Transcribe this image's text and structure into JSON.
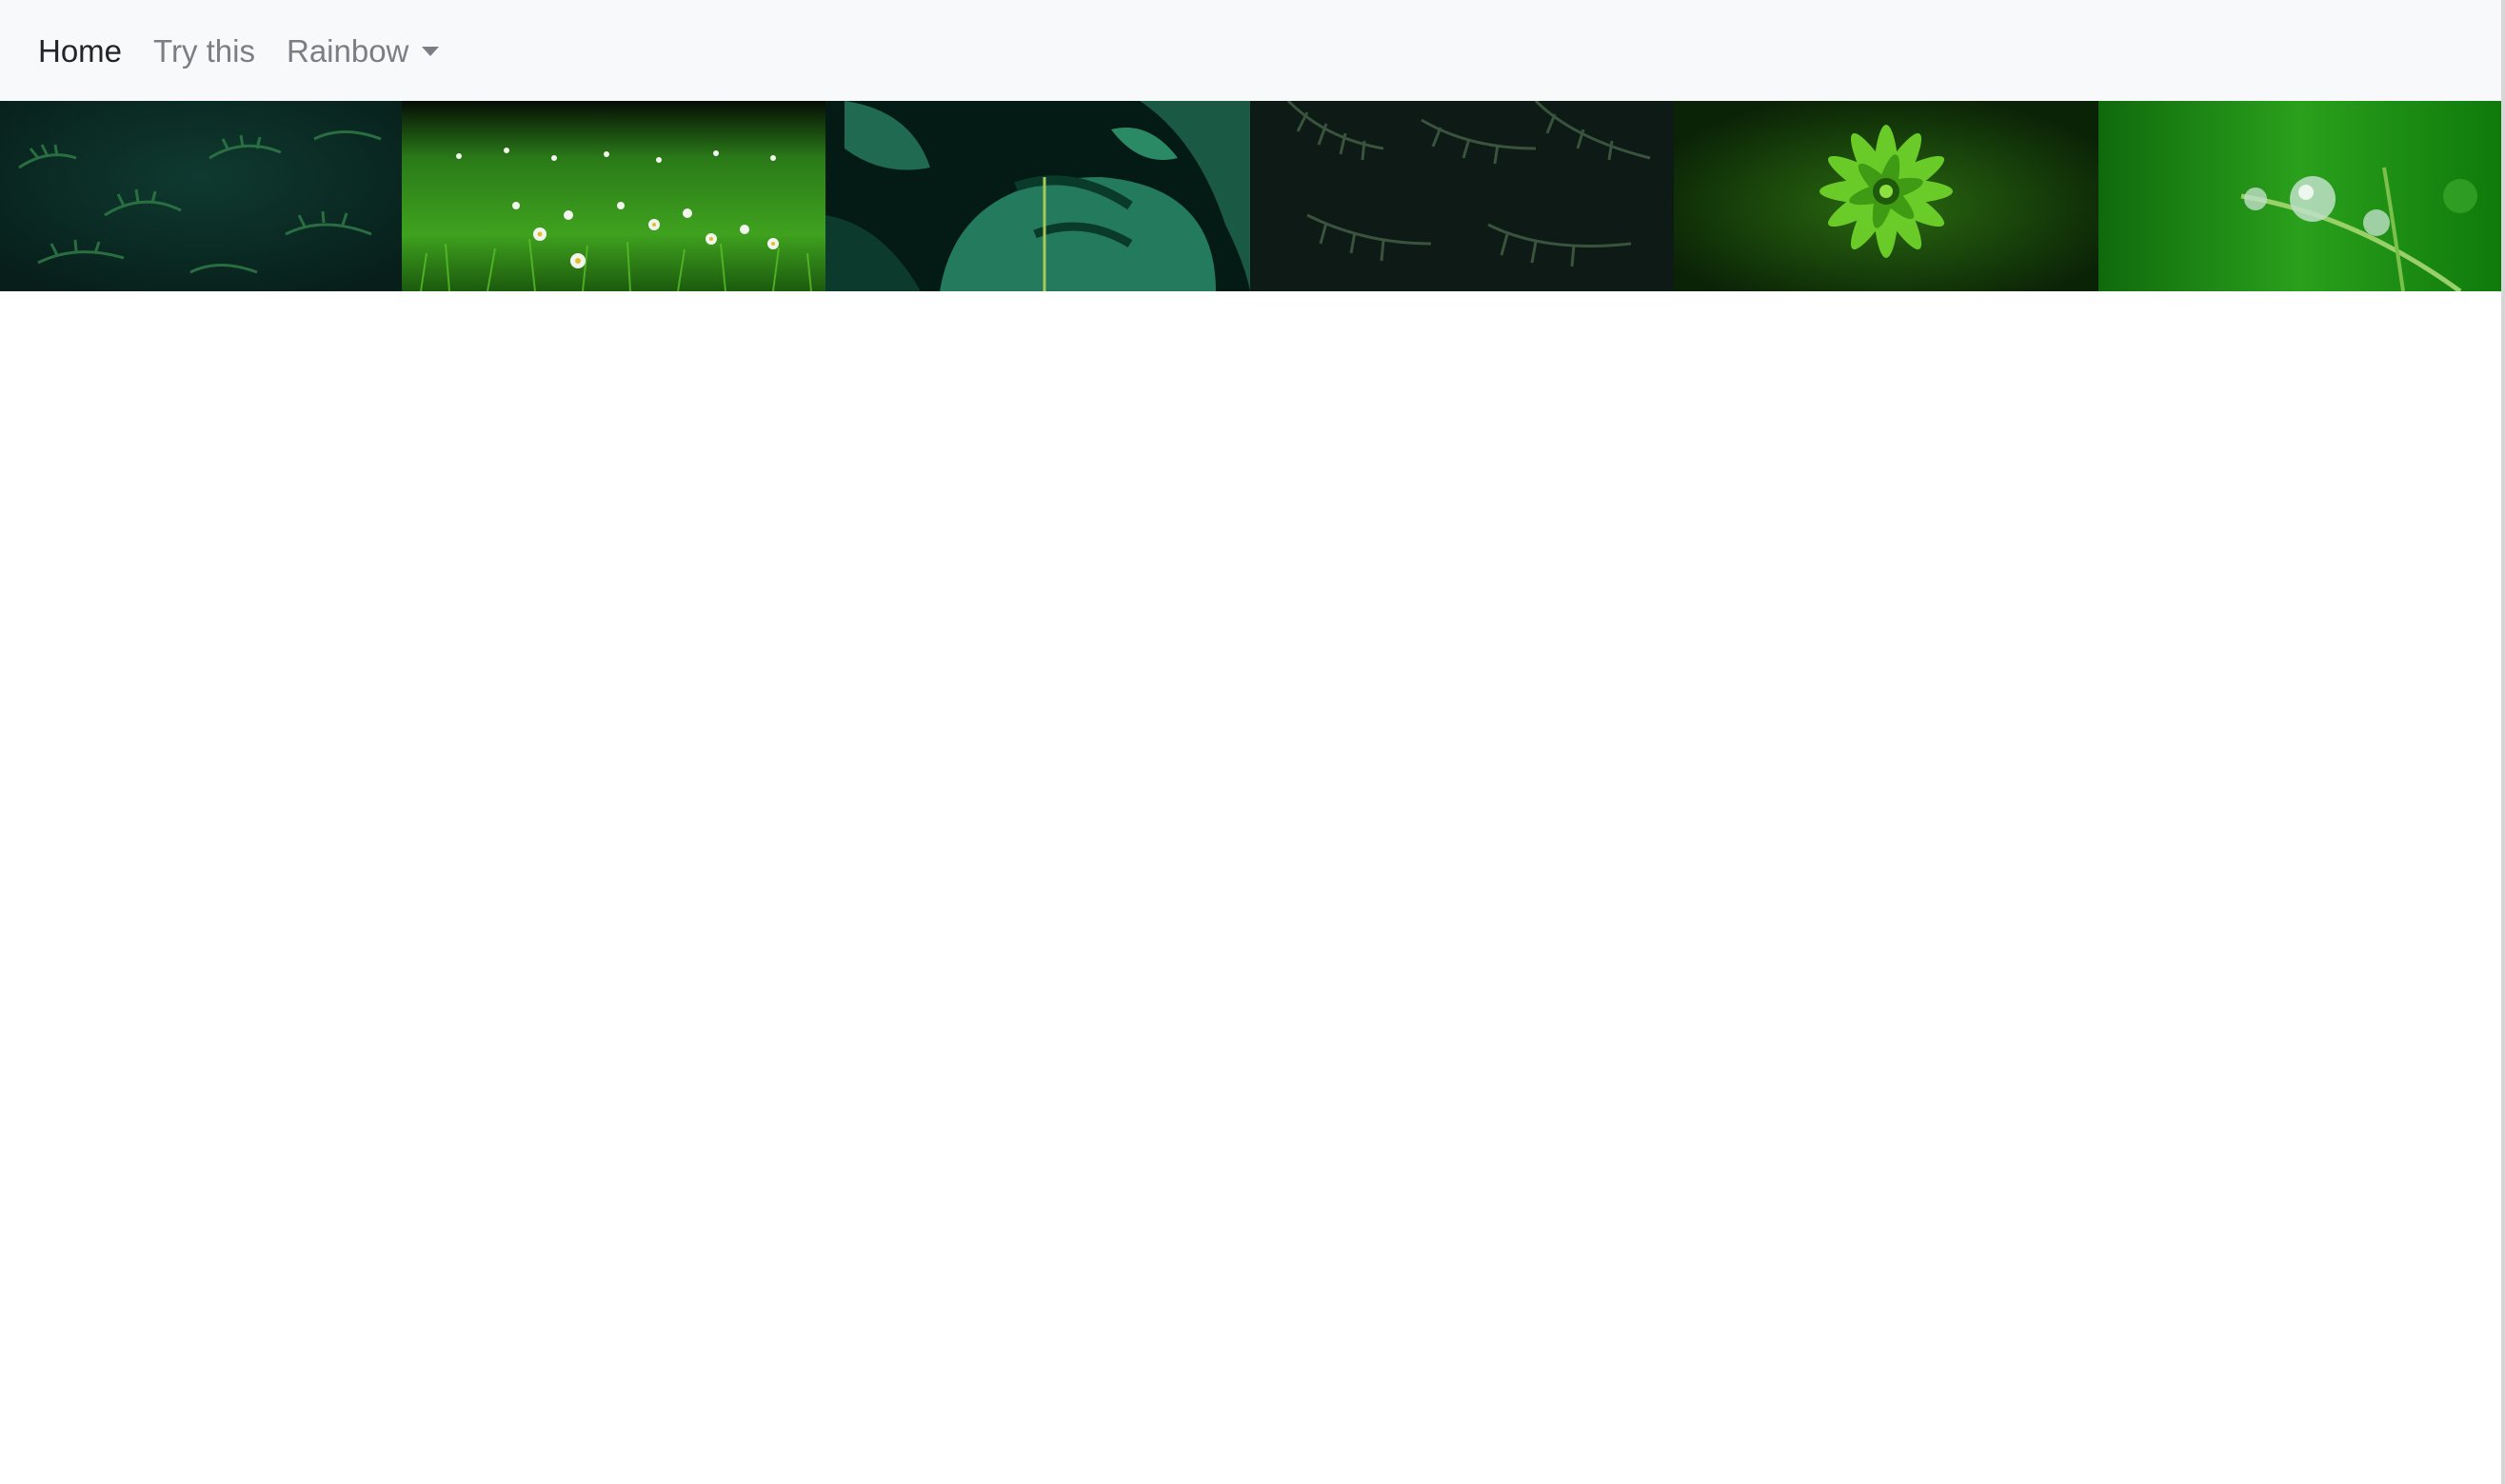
{
  "navbar": {
    "items": [
      {
        "label": "Home",
        "active": true
      },
      {
        "label": "Try this",
        "active": false
      },
      {
        "label": "Rainbow",
        "active": false,
        "dropdown": true
      }
    ]
  },
  "gallery": {
    "images": [
      {
        "name": "fern-leaves",
        "base_color": "#0b2a24"
      },
      {
        "name": "grass-daisies",
        "base_color": "#2f8a1a"
      },
      {
        "name": "monstera-leaf",
        "base_color": "#06241c"
      },
      {
        "name": "palm-fronds",
        "base_color": "#0f1a16"
      },
      {
        "name": "green-succulent",
        "base_color": "#1a4a0a"
      },
      {
        "name": "dew-drop-grass",
        "base_color": "#1e8a14"
      }
    ]
  }
}
